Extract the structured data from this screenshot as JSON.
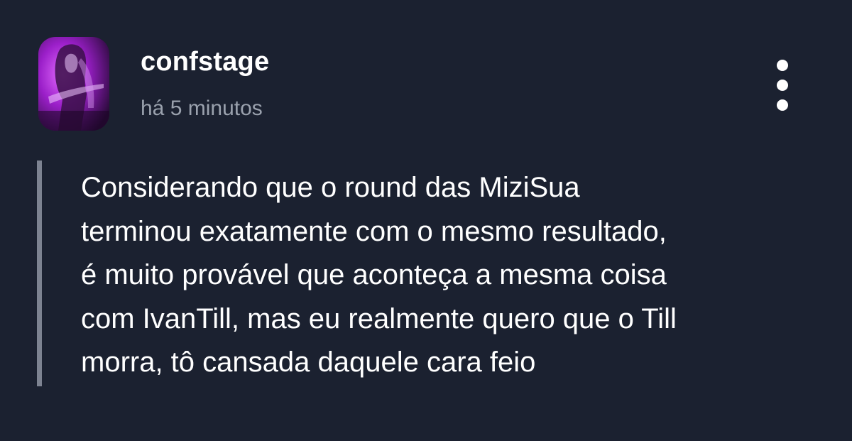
{
  "post": {
    "author": "confstage",
    "timestamp": "há 5 minutos",
    "body": "Considerando que o round das MiziSua\nterminou exatamente com o mesmo resultado,\né muito provável que aconteça a mesma coisa\ncom IvanTill, mas eu realmente quero que o Till\nmorra, tô cansada daquele cara feio",
    "more_icon": "more-vertical-icon"
  },
  "colors": {
    "background": "#1b2130",
    "quote_bar": "#7d8391",
    "timestamp": "#9aa1ad",
    "text": "#ffffff",
    "avatar_accent": "#b42be0"
  }
}
